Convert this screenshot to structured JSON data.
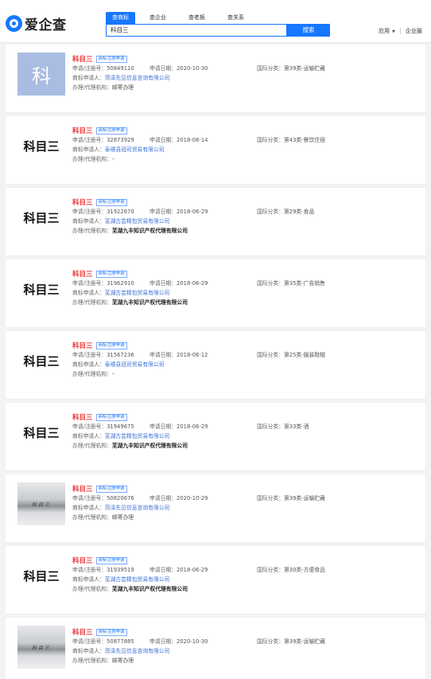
{
  "header": {
    "logo_text": "爱企查",
    "tabs": [
      "查商标",
      "查企业",
      "查老板",
      "查关系"
    ],
    "search_value": "科目三",
    "search_button": "搜索",
    "apps_label": "应用",
    "enterprise_label": "企业服"
  },
  "labels": {
    "reg_no": "申请/注册号：",
    "apply_date": "申请日期：",
    "intl_class": "国际分类：",
    "applicant": "商标申请人：",
    "agent": "办理/代理机构："
  },
  "results": [
    {
      "name": "科目三",
      "tag": "商标注册申请",
      "thumb_type": "blue",
      "thumb_text": "科",
      "reg_no": "50849110",
      "date": "2020-10-30",
      "intl_class": "第39类-运输贮藏",
      "applicant": "菏泽先见信息咨询有限公司",
      "agent": "邮寄办理"
    },
    {
      "name": "科目三",
      "tag": "商标注册申请",
      "thumb_type": "text",
      "thumb_text": "科目三",
      "reg_no": "32873929",
      "date": "2018-08-14",
      "intl_class": "第43类-餐饮住宿",
      "applicant": "泰顺县冠司贸易有限公司",
      "agent": "–"
    },
    {
      "name": "科目三",
      "tag": "商标注册申请",
      "thumb_type": "text",
      "thumb_text": "科目三",
      "reg_no": "31922670",
      "date": "2018-06-29",
      "intl_class": "第29类-食品",
      "applicant": "芜湖古芸精包贸易有限公司",
      "agent": "芜湖九丰知识产权代理有限公司"
    },
    {
      "name": "科目三",
      "tag": "商标注册申请",
      "thumb_type": "text",
      "thumb_text": "科目三",
      "reg_no": "31962910",
      "date": "2018-06-29",
      "intl_class": "第35类-广告销售",
      "applicant": "芜湖古芸精包贸易有限公司",
      "agent": "芜湖九丰知识产权代理有限公司"
    },
    {
      "name": "科目三",
      "tag": "商标注册申请",
      "thumb_type": "text",
      "thumb_text": "科目三",
      "reg_no": "31567236",
      "date": "2018-06-12",
      "intl_class": "第25类-服装鞋帽",
      "applicant": "泰顺县冠司贸易有限公司",
      "agent": "–"
    },
    {
      "name": "科目三",
      "tag": "商标注册申请",
      "thumb_type": "text",
      "thumb_text": "科目三",
      "reg_no": "31949675",
      "date": "2018-06-29",
      "intl_class": "第33类-酒",
      "applicant": "芜湖古芸精包贸易有限公司",
      "agent": "芜湖九丰知识产权代理有限公司"
    },
    {
      "name": "科目三",
      "tag": "商标注册申请",
      "thumb_type": "photo",
      "thumb_text": "",
      "reg_no": "50820676",
      "date": "2020-10-29",
      "intl_class": "第39类-运输贮藏",
      "applicant": "菏泽先见信息咨询有限公司",
      "agent": "邮寄办理"
    },
    {
      "name": "科目三",
      "tag": "商标注册申请",
      "thumb_type": "text",
      "thumb_text": "科目三",
      "reg_no": "31939519",
      "date": "2018-06-29",
      "intl_class": "第30类-方便食品",
      "applicant": "芜湖古芸精包贸易有限公司",
      "agent": "芜湖九丰知识产权代理有限公司"
    },
    {
      "name": "科目三",
      "tag": "商标注册申请",
      "thumb_type": "photo",
      "thumb_text": "",
      "reg_no": "50877885",
      "date": "2020-10-30",
      "intl_class": "第39类-运输贮藏",
      "applicant": "菏泽先见信息咨询有限公司",
      "agent": "邮寄办理"
    }
  ]
}
